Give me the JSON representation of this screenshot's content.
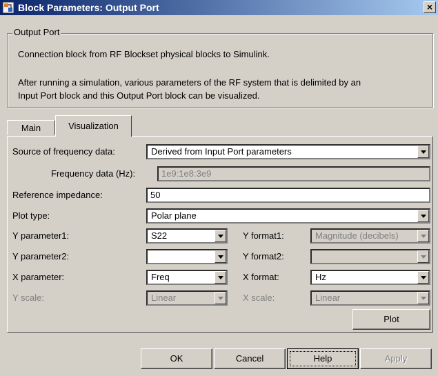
{
  "window": {
    "title": "Block Parameters: Output Port",
    "close_symbol": "×"
  },
  "group": {
    "legend": "Output Port",
    "description1": "Connection block from RF Blockset physical blocks to Simulink.",
    "description2": "After running a simulation, various parameters of the RF system that is delimited by an",
    "description3": "Input Port block and this Output Port block can be visualized."
  },
  "tabs": [
    {
      "label": "Main",
      "active": false
    },
    {
      "label": "Visualization",
      "active": true
    }
  ],
  "form": {
    "source_label": "Source of frequency data:",
    "source_value": "Derived from Input Port parameters",
    "freq_label": "Frequency data (Hz):",
    "freq_value": "1e9:1e8:3e9",
    "refimp_label": "Reference impedance:",
    "refimp_value": "50",
    "plottype_label": "Plot type:",
    "plottype_value": "Polar plane",
    "yparam1_label": "Y parameter1:",
    "yparam1_value": "S22",
    "yformat1_label": "Y format1:",
    "yformat1_value": "Magnitude (decibels)",
    "yparam2_label": "Y parameter2:",
    "yparam2_value": "",
    "yformat2_label": "Y format2:",
    "yformat2_value": "",
    "xparam_label": "X parameter:",
    "xparam_value": "Freq",
    "xformat_label": "X format:",
    "xformat_value": "Hz",
    "yscale_label": "Y scale:",
    "yscale_value": "Linear",
    "xscale_label": "X scale:",
    "xscale_value": "Linear",
    "plot_button": "Plot"
  },
  "buttons": {
    "ok": "OK",
    "cancel": "Cancel",
    "help": "Help",
    "apply": "Apply"
  },
  "colors": {
    "title_gradient_start": "#0a246a",
    "title_gradient_end": "#a6caf0",
    "dialog_face": "#d4d0c8"
  }
}
